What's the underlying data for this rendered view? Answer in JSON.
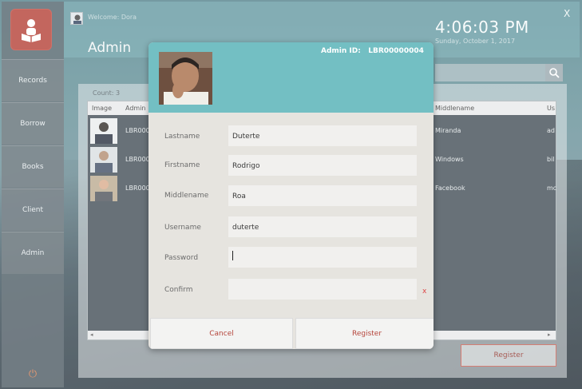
{
  "header": {
    "welcome": "Welcome: Dora",
    "page_title": "Admin",
    "time": "4:06:03 PM",
    "date": "Sunday, October 1, 2017",
    "close": "X"
  },
  "sidebar": {
    "items": [
      {
        "label": "Records"
      },
      {
        "label": "Borrow"
      },
      {
        "label": "Books"
      },
      {
        "label": "Client"
      },
      {
        "label": "Admin"
      }
    ]
  },
  "table": {
    "count": "Count: 3",
    "columns": [
      "Image",
      "Admin",
      "Middlename",
      "Us"
    ],
    "rows": [
      {
        "admin": "LBR000",
        "middlename": "Miranda",
        "user": "ad"
      },
      {
        "admin": "LBR000",
        "middlename": "Windows",
        "user": "bil"
      },
      {
        "admin": "LBR000",
        "middlename": "Facebook",
        "user": "mc"
      }
    ]
  },
  "bg_register": "Register",
  "modal": {
    "admin_id_label": "Admin ID:",
    "admin_id": "LBR00000004",
    "fields": {
      "lastname_label": "Lastname",
      "lastname": "Duterte",
      "firstname_label": "Firstname",
      "firstname": "Rodrigo",
      "middlename_label": "Middlename",
      "middlename": "Roa",
      "username_label": "Username",
      "username": "duterte",
      "password_label": "Password",
      "password": "",
      "confirm_label": "Confirm",
      "confirm": ""
    },
    "error_mark": "x",
    "cancel": "Cancel",
    "register": "Register"
  },
  "icons": {
    "logo": "reader-icon",
    "search": "search-icon",
    "power": "power-icon"
  },
  "colors": {
    "accent": "#73bfc3",
    "brand_red": "#b23b31",
    "button_text": "#b5453b"
  }
}
